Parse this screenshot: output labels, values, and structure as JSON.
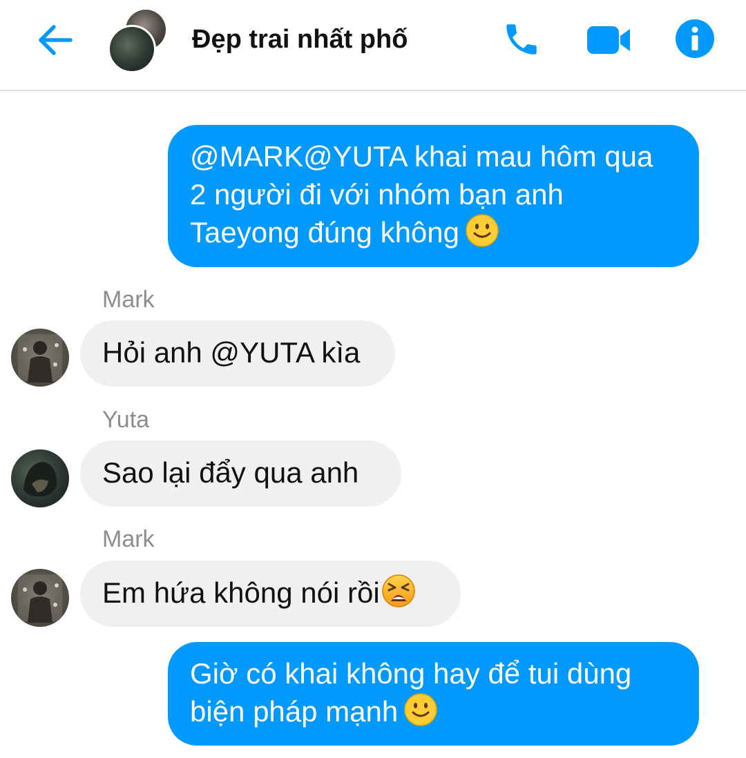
{
  "header": {
    "title": "Đẹp trai nhất phố",
    "icons": {
      "back": "arrow-left-icon",
      "call": "phone-icon",
      "video": "video-camera-icon",
      "info": "info-icon"
    },
    "accent_color": "#0099ff"
  },
  "messages": [
    {
      "direction": "outgoing",
      "text": "@MARK@YUTA khai mau hôm qua 2 người đi với nhóm bạn anh Taeyong đúng không",
      "emoji": "slightly-smiling-face"
    },
    {
      "direction": "incoming",
      "sender": "Mark",
      "text": "Hỏi anh @YUTA kìa"
    },
    {
      "direction": "incoming",
      "sender": "Yuta",
      "text": "Sao lại đẩy qua anh"
    },
    {
      "direction": "incoming",
      "sender": "Mark",
      "text": "Em hứa không nói rồi",
      "emoji": "tired-face"
    },
    {
      "direction": "outgoing",
      "text": "Giờ có khai không hay để tui dùng biện pháp mạnh",
      "emoji": "slightly-smiling-face"
    }
  ],
  "colors": {
    "outgoing_bubble": "#0099ff",
    "incoming_bubble": "#f1f0f0",
    "sender_name": "#8d8d8d"
  }
}
